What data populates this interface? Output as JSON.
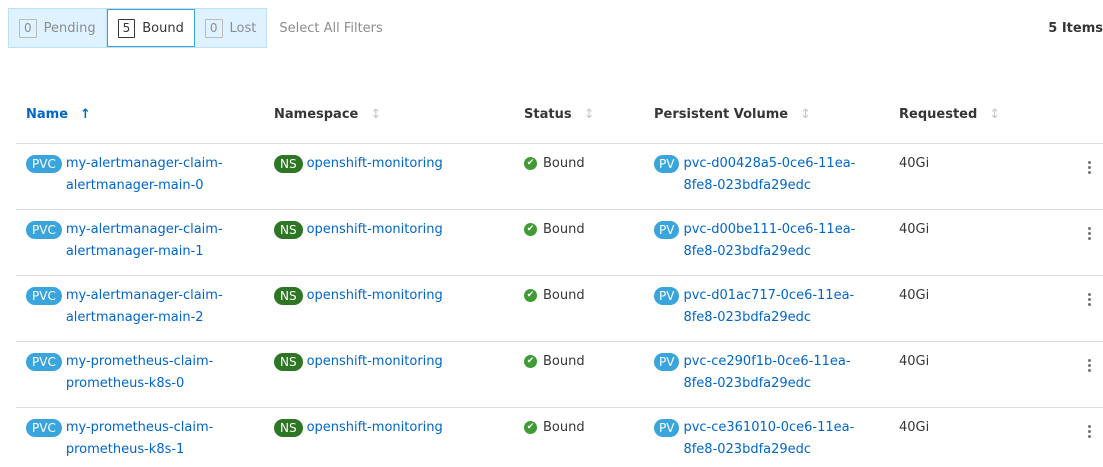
{
  "filters": [
    {
      "count": "0",
      "label": "Pending",
      "active": false
    },
    {
      "count": "5",
      "label": "Bound",
      "active": true
    },
    {
      "count": "0",
      "label": "Lost",
      "active": false
    }
  ],
  "select_all_label": "Select All Filters",
  "item_count": "5 Items",
  "columns": {
    "name": "Name",
    "namespace": "Namespace",
    "status": "Status",
    "persistent_volume": "Persistent Volume",
    "requested": "Requested"
  },
  "badges": {
    "pvc": "PVC",
    "ns": "NS",
    "pv": "PV"
  },
  "rows": [
    {
      "name_line1": "my-alertmanager-claim-",
      "name_line2": "alertmanager-main-0",
      "namespace": "openshift-monitoring",
      "status": "Bound",
      "pv_line1": "pvc-d00428a5-0ce6-11ea-",
      "pv_line2": "8fe8-023bdfa29edc",
      "requested": "40Gi"
    },
    {
      "name_line1": "my-alertmanager-claim-",
      "name_line2": "alertmanager-main-1",
      "namespace": "openshift-monitoring",
      "status": "Bound",
      "pv_line1": "pvc-d00be111-0ce6-11ea-",
      "pv_line2": "8fe8-023bdfa29edc",
      "requested": "40Gi"
    },
    {
      "name_line1": "my-alertmanager-claim-",
      "name_line2": "alertmanager-main-2",
      "namespace": "openshift-monitoring",
      "status": "Bound",
      "pv_line1": "pvc-d01ac717-0ce6-11ea-",
      "pv_line2": "8fe8-023bdfa29edc",
      "requested": "40Gi"
    },
    {
      "name_line1": "my-prometheus-claim-",
      "name_line2": "prometheus-k8s-0",
      "namespace": "openshift-monitoring",
      "status": "Bound",
      "pv_line1": "pvc-ce290f1b-0ce6-11ea-",
      "pv_line2": "8fe8-023bdfa29edc",
      "requested": "40Gi"
    },
    {
      "name_line1": "my-prometheus-claim-",
      "name_line2": "prometheus-k8s-1",
      "namespace": "openshift-monitoring",
      "status": "Bound",
      "pv_line1": "pvc-ce361010-0ce6-11ea-",
      "pv_line2": "8fe8-023bdfa29edc",
      "requested": "40Gi"
    }
  ],
  "icons": {
    "sort_active": "arrow-up-icon",
    "sort_inactive": "sort-icon",
    "status": "check-circle-icon",
    "row_actions": "kebab-icon"
  },
  "colors": {
    "link": "#0066cc",
    "pvc_badge": "#39a5dc",
    "ns_badge": "#2d7623",
    "status_ok": "#3f9c35",
    "filter_bg": "#def3ff"
  }
}
